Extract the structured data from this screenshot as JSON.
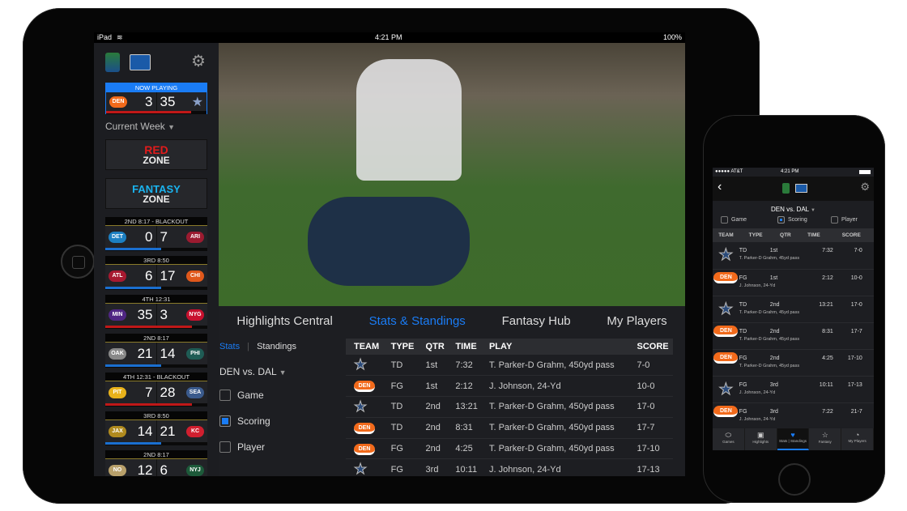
{
  "colors": {
    "accent": "#1a7cf5",
    "broncos": "#f26a1b",
    "cowboys": "#0c2f5a",
    "red_zone": "#e21b1b",
    "fantasy_zone": "#1ab4f0"
  },
  "ipad": {
    "status": {
      "device": "iPad",
      "time": "4:21 PM",
      "battery": "100%"
    },
    "sidebar": {
      "now_playing_label": "NOW PLAYING",
      "now_playing": {
        "home": "DEN",
        "home_score": "3",
        "away_score": "35",
        "away": "DAL",
        "progress": 0.85,
        "bar_color": "#c01818"
      },
      "week_selector": "Current Week",
      "red_zone": {
        "line1": "RED",
        "line2": "ZONE"
      },
      "fantasy_zone": {
        "line1": "FANTASY",
        "line2": "ZONE"
      },
      "games": [
        {
          "status": "2ND  8:17 - BLACKOUT",
          "home": "DET",
          "home_score": "0",
          "away_score": "7",
          "away": "ARI",
          "progress": 0.55,
          "bar_color": "#1a6fd0",
          "home_color": "#1c7fc1",
          "away_color": "#9b1b30"
        },
        {
          "status": "3RD  8:50",
          "home": "ATL",
          "home_score": "6",
          "away_score": "17",
          "away": "CHI",
          "progress": 0.55,
          "bar_color": "#1a6fd0",
          "home_color": "#a71930",
          "away_color": "#e0581b"
        },
        {
          "status": "4TH  12:31",
          "home": "MIN",
          "home_score": "35",
          "away_score": "3",
          "away": "NYG",
          "progress": 0.85,
          "bar_color": "#c01818",
          "home_color": "#4f2683",
          "away_color": "#c8102e"
        },
        {
          "status": "2ND  8:17",
          "home": "OAK",
          "home_score": "21",
          "away_score": "14",
          "away": "PHI",
          "progress": 0.55,
          "bar_color": "#1a6fd0",
          "home_color": "#888888",
          "away_color": "#1f5c55"
        },
        {
          "status": "4TH  12:31 - BLACKOUT",
          "home": "PIT",
          "home_score": "7",
          "away_score": "28",
          "away": "SEA",
          "progress": 0.85,
          "bar_color": "#c01818",
          "home_color": "#e8b21b",
          "away_color": "#3a5a8c"
        },
        {
          "status": "3RD  8:50",
          "home": "JAX",
          "home_score": "14",
          "away_score": "21",
          "away": "KC",
          "progress": 0.55,
          "bar_color": "#1a6fd0",
          "home_color": "#b08a1e",
          "away_color": "#d01f2f"
        },
        {
          "status": "2ND  8:17",
          "home": "NO",
          "home_score": "12",
          "away_score": "6",
          "away": "NYJ",
          "progress": 0.55,
          "bar_color": "#1a6fd0",
          "home_color": "#b8a06a",
          "away_color": "#1d5a3a"
        }
      ]
    },
    "tabs": [
      "Highlights Central",
      "Stats & Standings",
      "Fantasy Hub",
      "My Players"
    ],
    "subtabs": {
      "stats": "Stats",
      "standings": "Standings"
    },
    "matchup": "DEN vs. DAL",
    "filters": [
      {
        "label": "Game",
        "checked": false
      },
      {
        "label": "Scoring",
        "checked": true
      },
      {
        "label": "Player",
        "checked": false
      }
    ],
    "table": {
      "headers": [
        "TEAM",
        "TYPE",
        "QTR",
        "TIME",
        "PLAY",
        "SCORE"
      ],
      "rows": [
        {
          "team": "DAL",
          "type": "TD",
          "qtr": "1st",
          "time": "7:32",
          "play": "T. Parker-D Grahm, 450yd pass",
          "score": "7-0"
        },
        {
          "team": "DEN",
          "type": "FG",
          "qtr": "1st",
          "time": "2:12",
          "play": "J. Johnson, 24-Yd",
          "score": "10-0"
        },
        {
          "team": "DAL",
          "type": "TD",
          "qtr": "2nd",
          "time": "13:21",
          "play": "T. Parker-D Grahm, 450yd pass",
          "score": "17-0"
        },
        {
          "team": "DEN",
          "type": "TD",
          "qtr": "2nd",
          "time": "8:31",
          "play": "T. Parker-D Grahm, 450yd pass",
          "score": "17-7"
        },
        {
          "team": "DEN",
          "type": "FG",
          "qtr": "2nd",
          "time": "4:25",
          "play": "T. Parker-D Grahm, 450yd pass",
          "score": "17-10"
        },
        {
          "team": "DAL",
          "type": "FG",
          "qtr": "3rd",
          "time": "10:11",
          "play": "J. Johnson, 24-Yd",
          "score": "17-13"
        }
      ]
    }
  },
  "iphone": {
    "status": {
      "carrier": "●●●●● AT&T",
      "time": "4:21 PM"
    },
    "matchup": "DEN vs. DAL",
    "filters": [
      {
        "label": "Game",
        "checked": false
      },
      {
        "label": "Scoring",
        "checked": true
      },
      {
        "label": "Player",
        "checked": false
      }
    ],
    "table": {
      "headers": [
        "TEAM",
        "TYPE",
        "QTR",
        "TIME",
        "SCORE"
      ],
      "rows": [
        {
          "team": "DAL",
          "type": "TD",
          "qtr": "1st",
          "time": "7:32",
          "score": "7-0",
          "play": "T. Parker-D Grahm, 45yd pass"
        },
        {
          "team": "DEN",
          "type": "FG",
          "qtr": "1st",
          "time": "2:12",
          "score": "10-0",
          "play": "J. Johnson, 24-Yd"
        },
        {
          "team": "DAL",
          "type": "TD",
          "qtr": "2nd",
          "time": "13:21",
          "score": "17-0",
          "play": "T. Parker-D Grahm, 45yd pass"
        },
        {
          "team": "DEN",
          "type": "TD",
          "qtr": "2nd",
          "time": "8:31",
          "score": "17-7",
          "play": "T. Parker-D Grahm, 45yd pass"
        },
        {
          "team": "DEN",
          "type": "FG",
          "qtr": "2nd",
          "time": "4:25",
          "score": "17-10",
          "play": "T. Parker-D Grahm, 45yd pass"
        },
        {
          "team": "DAL",
          "type": "FG",
          "qtr": "3rd",
          "time": "10:11",
          "score": "17-13",
          "play": "J. Johnson, 24-Yd"
        },
        {
          "team": "DEN",
          "type": "FG",
          "qtr": "3rd",
          "time": "7:22",
          "score": "21-7",
          "play": "J. Johnson, 24-Yd"
        }
      ]
    },
    "tabbar": [
      {
        "label": "Games",
        "icon": "football-icon"
      },
      {
        "label": "Highlights",
        "icon": "video-icon"
      },
      {
        "label": "Stats | Standings",
        "icon": "trophy-icon",
        "active": true
      },
      {
        "label": "Fantasy",
        "icon": "star-icon"
      },
      {
        "label": "My Players",
        "icon": "player-icon"
      }
    ]
  }
}
